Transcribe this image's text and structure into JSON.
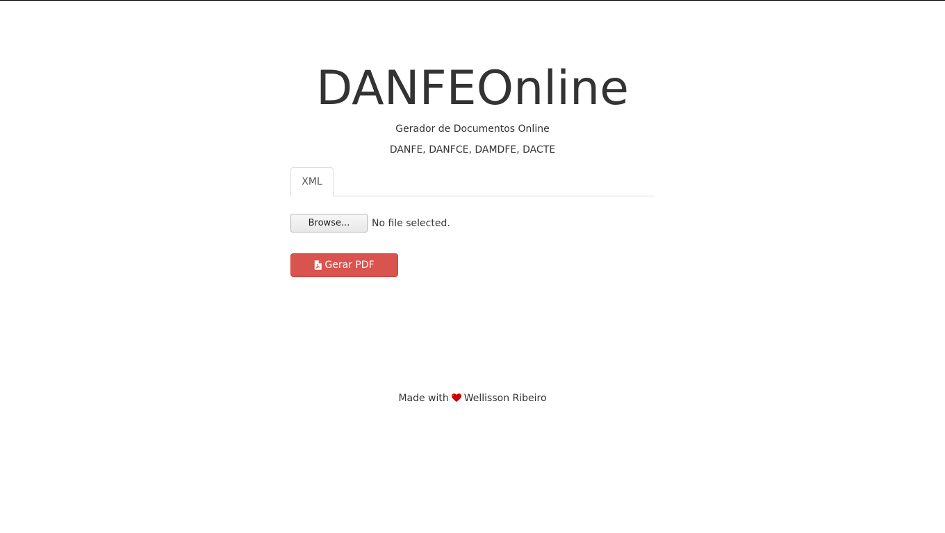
{
  "header": {
    "title": "DANFEOnline",
    "subtitle": "Gerador de Documentos Online",
    "doc_types": "DANFE, DANFCE, DAMDFE, DACTE"
  },
  "tabs": [
    {
      "label": "XML",
      "active": true
    }
  ],
  "upload": {
    "browse_label": "Browse...",
    "file_status": "No file selected."
  },
  "actions": {
    "generate_label": "Gerar PDF",
    "generate_icon": "file-pdf-icon",
    "generate_color": "#d9534f"
  },
  "footer": {
    "made_with": "Made with",
    "heart_icon": "heart-icon",
    "heart_color": "#cc0000",
    "author": "Wellisson Ribeiro"
  }
}
